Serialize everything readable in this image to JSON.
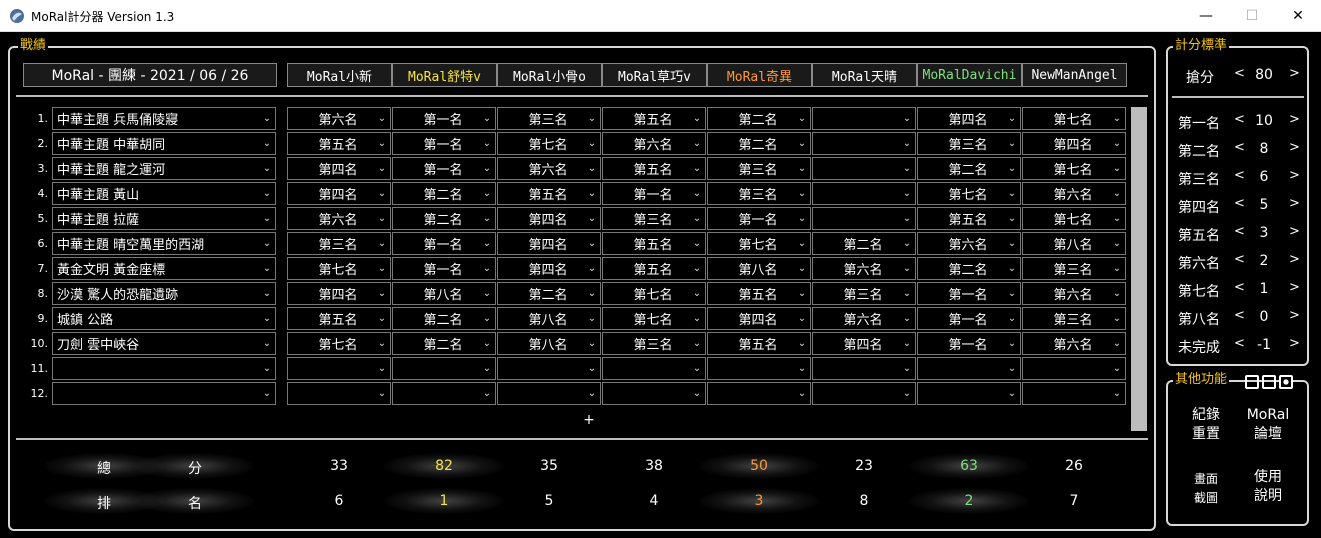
{
  "window": {
    "title": "MoRal計分器 Version 1.3"
  },
  "panels": {
    "main_title": "戰績",
    "side_title": "計分標準",
    "func_title": "其他功能"
  },
  "event_name": "MoRal - 團練 - 2021 / 06 / 26",
  "colors": {
    "accent": "#f5c518",
    "orange": "#ff9933",
    "green": "#7ee07e",
    "white": "#ffffff"
  },
  "players": [
    {
      "name": "MoRal小新",
      "color": "#ffffff"
    },
    {
      "name": "MoRal舒特v",
      "color": "#f5e642"
    },
    {
      "name": "MoRal小骨o",
      "color": "#ffffff"
    },
    {
      "name": "MoRal草巧v",
      "color": "#ffffff"
    },
    {
      "name": "MoRal奇異",
      "color": "#ff9933"
    },
    {
      "name": "MoRal天晴",
      "color": "#ffffff"
    },
    {
      "name": "MoRalDavichi",
      "color": "#7ee07e"
    },
    {
      "name": "NewManAngel",
      "color": "#ffffff"
    }
  ],
  "rows": [
    {
      "num": "1.",
      "map": "中華主題 兵馬俑陵寢",
      "ranks": [
        "第六名",
        "第一名",
        "第三名",
        "第五名",
        "第二名",
        "",
        "第四名",
        "第七名"
      ]
    },
    {
      "num": "2.",
      "map": "中華主題 中華胡同",
      "ranks": [
        "第五名",
        "第一名",
        "第七名",
        "第六名",
        "第二名",
        "",
        "第三名",
        "第四名"
      ]
    },
    {
      "num": "3.",
      "map": "中華主題 龍之運河",
      "ranks": [
        "第四名",
        "第一名",
        "第六名",
        "第五名",
        "第三名",
        "",
        "第二名",
        "第七名"
      ]
    },
    {
      "num": "4.",
      "map": "中華主題 黃山",
      "ranks": [
        "第四名",
        "第二名",
        "第五名",
        "第一名",
        "第三名",
        "",
        "第七名",
        "第六名"
      ]
    },
    {
      "num": "5.",
      "map": "中華主題 拉薩",
      "ranks": [
        "第六名",
        "第二名",
        "第四名",
        "第三名",
        "第一名",
        "",
        "第五名",
        "第七名"
      ]
    },
    {
      "num": "6.",
      "map": "中華主題 晴空萬里的西湖",
      "ranks": [
        "第三名",
        "第一名",
        "第四名",
        "第五名",
        "第七名",
        "第二名",
        "第六名",
        "第八名"
      ]
    },
    {
      "num": "7.",
      "map": "黃金文明 黃金座標",
      "ranks": [
        "第七名",
        "第一名",
        "第四名",
        "第五名",
        "第八名",
        "第六名",
        "第二名",
        "第三名"
      ]
    },
    {
      "num": "8.",
      "map": "沙漠 驚人的恐龍遺跡",
      "ranks": [
        "第四名",
        "第八名",
        "第二名",
        "第七名",
        "第五名",
        "第三名",
        "第一名",
        "第六名"
      ]
    },
    {
      "num": "9.",
      "map": "城鎮 公路",
      "ranks": [
        "第五名",
        "第二名",
        "第八名",
        "第七名",
        "第四名",
        "第六名",
        "第一名",
        "第三名"
      ]
    },
    {
      "num": "10.",
      "map": "刀劍 雲中峽谷",
      "ranks": [
        "第七名",
        "第二名",
        "第八名",
        "第三名",
        "第五名",
        "第四名",
        "第一名",
        "第六名"
      ]
    },
    {
      "num": "11.",
      "map": "",
      "ranks": [
        "",
        "",
        "",
        "",
        "",
        "",
        "",
        ""
      ]
    },
    {
      "num": "12.",
      "map": "",
      "ranks": [
        "",
        "",
        "",
        "",
        "",
        "",
        "",
        ""
      ]
    }
  ],
  "add_row_label": "+",
  "summary": {
    "total_label": [
      "總",
      "分"
    ],
    "rank_label": [
      "排",
      "名"
    ],
    "totals": [
      "33",
      "82",
      "35",
      "38",
      "50",
      "23",
      "63",
      "26"
    ],
    "ranks": [
      "6",
      "1",
      "5",
      "4",
      "3",
      "8",
      "2",
      "7"
    ]
  },
  "scoring": {
    "grab": {
      "label": "搶分",
      "value": "80"
    },
    "items": [
      {
        "label": "第一名",
        "value": "10"
      },
      {
        "label": "第二名",
        "value": "8"
      },
      {
        "label": "第三名",
        "value": "6"
      },
      {
        "label": "第四名",
        "value": "5"
      },
      {
        "label": "第五名",
        "value": "3"
      },
      {
        "label": "第六名",
        "value": "2"
      },
      {
        "label": "第七名",
        "value": "1"
      },
      {
        "label": "第八名",
        "value": "0"
      },
      {
        "label": "未完成",
        "value": "-1"
      }
    ],
    "dec": "<",
    "inc": ">"
  },
  "functions": {
    "reset_records": [
      "紀錄",
      "重置"
    ],
    "forum": [
      "MoRal",
      "論壇"
    ],
    "screenshot": [
      "畫面",
      "截圖"
    ],
    "help": [
      "使用",
      "說明"
    ]
  }
}
